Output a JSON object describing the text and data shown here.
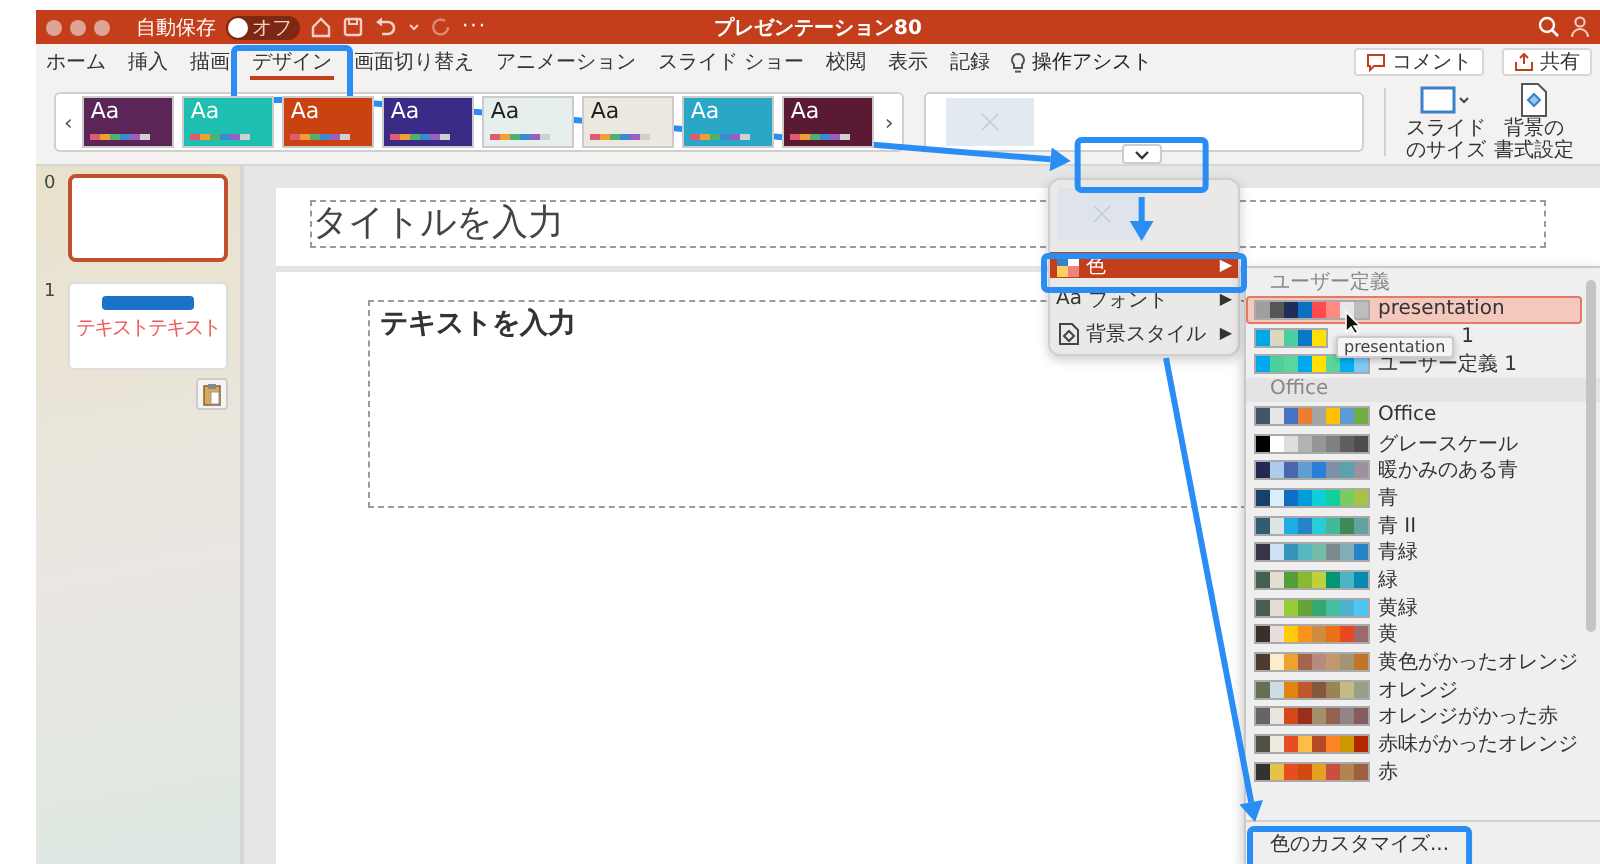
{
  "window": {
    "autosave_label": "自動保存",
    "autosave_on": false,
    "autosave_state": "オフ",
    "more": "···",
    "title": "プレゼンテーション80"
  },
  "ribbon_tabs": [
    {
      "label": "ホーム",
      "selected": false
    },
    {
      "label": "挿入",
      "selected": false
    },
    {
      "label": "描画",
      "selected": false
    },
    {
      "label": "デザイン",
      "selected": true
    },
    {
      "label": "画面切り替え",
      "selected": false
    },
    {
      "label": "アニメーション",
      "selected": false
    },
    {
      "label": "スライド ショー",
      "selected": false
    },
    {
      "label": "校閲",
      "selected": false
    },
    {
      "label": "表示",
      "selected": false
    },
    {
      "label": "記録",
      "selected": false
    }
  ],
  "tell_me": "操作アシスト",
  "header_buttons": [
    {
      "kind": "comment",
      "label": "コメント"
    },
    {
      "kind": "share",
      "label": "共有"
    }
  ],
  "gallery": {
    "prev": "‹",
    "next": "›"
  },
  "themes": [
    {
      "label": "Aa",
      "color": "#5b2558"
    },
    {
      "label": "Aa",
      "color": "#1ebfb0"
    },
    {
      "label": "Aa",
      "color": "#c9420f"
    },
    {
      "label": "Aa",
      "color": "#3b2a86"
    },
    {
      "label": "Aa",
      "color": "#e6eeee"
    },
    {
      "label": "Aa",
      "color": "#ece8df"
    },
    {
      "label": "Aa",
      "color": "#2aa6c6"
    },
    {
      "label": "Aa",
      "color": "#5a1a34"
    }
  ],
  "design_buttons": [
    {
      "kind": "slide-size",
      "lines": [
        "スライド",
        "のサイズ"
      ]
    },
    {
      "kind": "background",
      "lines": [
        "背景の",
        "書式設定"
      ]
    }
  ],
  "slides": [
    {
      "number": "0",
      "selected": true,
      "paste_options": false
    },
    {
      "number": "1",
      "selected": false,
      "paste_options": true,
      "text": "テキストテキスト"
    }
  ],
  "slide": {
    "title_placeholder": "タイトルを入力",
    "body_placeholder": "テキストを入力"
  },
  "variants_menu": {
    "items": [
      {
        "kind": "colors",
        "label": "色",
        "arrow": "▶",
        "selected": true
      },
      {
        "kind": "fonts",
        "icon_text": "Aa",
        "label": "フォント",
        "arrow": "▶",
        "selected": false
      },
      {
        "kind": "background",
        "label": "背景スタイル",
        "arrow": "▶",
        "selected": false
      }
    ]
  },
  "colors_submenu": {
    "sections": [
      {
        "title": "ユーザー定義",
        "schemes": [
          {
            "name": "presentation",
            "selected": true,
            "swatches": [
              {
                "color": "#9e9e9e"
              },
              {
                "color": "#555555"
              },
              {
                "color": "#1f2d5a"
              },
              {
                "color": "#0a70c0"
              },
              {
                "color": "#ff4b4b"
              },
              {
                "color": "#ff8a80"
              },
              {
                "color": "#e8e8e8"
              },
              {
                "color": "#bdbdbd"
              }
            ]
          },
          {
            "name": "1",
            "selected": false,
            "tooltip": "presentation",
            "swatches": [
              {
                "color": "#00a8e8"
              },
              {
                "color": "#dcd8c0"
              },
              {
                "color": "#4ccfa0"
              },
              {
                "color": "#0a78c8"
              },
              {
                "color": "#ffe000"
              }
            ]
          },
          {
            "name": "ユーザー定義 1",
            "selected": false,
            "swatches": [
              {
                "color": "#00a8f0"
              },
              {
                "color": "#4ccf9a"
              },
              {
                "color": "#5ad69c"
              },
              {
                "color": "#00a8f0"
              },
              {
                "color": "#ffe000"
              },
              {
                "color": "#5ad69c"
              },
              {
                "color": "#00b0f0"
              },
              {
                "color": "#7fc8f8"
              }
            ]
          }
        ]
      },
      {
        "title": "Office",
        "schemes": [
          {
            "name": "Office",
            "selected": false,
            "swatches": [
              {
                "color": "#44546a"
              },
              {
                "color": "#e7e6e6"
              },
              {
                "color": "#4472c4"
              },
              {
                "color": "#ed7d31"
              },
              {
                "color": "#a5a5a5"
              },
              {
                "color": "#ffc000"
              },
              {
                "color": "#5b9bd5"
              },
              {
                "color": "#70ad47"
              }
            ]
          },
          {
            "name": "グレースケール",
            "selected": false,
            "swatches": [
              {
                "color": "#000000"
              },
              {
                "color": "#ffffff"
              },
              {
                "color": "#dddddd"
              },
              {
                "color": "#b2b2b2"
              },
              {
                "color": "#969696"
              },
              {
                "color": "#808080"
              },
              {
                "color": "#5f5f5f"
              },
              {
                "color": "#4d4d4d"
              }
            ]
          },
          {
            "name": "暖かみのある青",
            "selected": false,
            "swatches": [
              {
                "color": "#242852"
              },
              {
                "color": "#acccea"
              },
              {
                "color": "#4a66ac"
              },
              {
                "color": "#629dd1"
              },
              {
                "color": "#297fd5"
              },
              {
                "color": "#7f8fa9"
              },
              {
                "color": "#5aa2ae"
              },
              {
                "color": "#9d90a0"
              }
            ]
          },
          {
            "name": "青",
            "selected": false,
            "swatches": [
              {
                "color": "#17406d"
              },
              {
                "color": "#dbeff9"
              },
              {
                "color": "#0f6fc6"
              },
              {
                "color": "#009dd9"
              },
              {
                "color": "#0bd0d9"
              },
              {
                "color": "#10cf9b"
              },
              {
                "color": "#7cca62"
              },
              {
                "color": "#a5c249"
              }
            ]
          },
          {
            "name": "青 II",
            "selected": false,
            "swatches": [
              {
                "color": "#335b74"
              },
              {
                "color": "#dfe3e5"
              },
              {
                "color": "#1cade4"
              },
              {
                "color": "#2683c6"
              },
              {
                "color": "#27ced7"
              },
              {
                "color": "#42ba97"
              },
              {
                "color": "#3e8853"
              },
              {
                "color": "#62a39f"
              }
            ]
          },
          {
            "name": "青緑",
            "selected": false,
            "swatches": [
              {
                "color": "#373545"
              },
              {
                "color": "#cee1f2"
              },
              {
                "color": "#3494ba"
              },
              {
                "color": "#58b6c0"
              },
              {
                "color": "#75bda7"
              },
              {
                "color": "#7a8c8e"
              },
              {
                "color": "#84acb6"
              },
              {
                "color": "#2683c6"
              }
            ]
          },
          {
            "name": "緑",
            "selected": false,
            "swatches": [
              {
                "color": "#455f51"
              },
              {
                "color": "#e3ded1"
              },
              {
                "color": "#549e39"
              },
              {
                "color": "#8ab833"
              },
              {
                "color": "#c0cf3a"
              },
              {
                "color": "#029676"
              },
              {
                "color": "#4ab5c4"
              },
              {
                "color": "#0989b1"
              }
            ]
          },
          {
            "name": "黄緑",
            "selected": false,
            "swatches": [
              {
                "color": "#455f51"
              },
              {
                "color": "#e3ded1"
              },
              {
                "color": "#99cb38"
              },
              {
                "color": "#63a537"
              },
              {
                "color": "#37a76f"
              },
              {
                "color": "#44c1a3"
              },
              {
                "color": "#4eb3cf"
              },
              {
                "color": "#51c3f9"
              }
            ]
          },
          {
            "name": "黄",
            "selected": false,
            "swatches": [
              {
                "color": "#39302a"
              },
              {
                "color": "#e5dedb"
              },
              {
                "color": "#ffca08"
              },
              {
                "color": "#f8931d"
              },
              {
                "color": "#ce8d3e"
              },
              {
                "color": "#ec7016"
              },
              {
                "color": "#e64823"
              },
              {
                "color": "#9c6a6a"
              }
            ]
          },
          {
            "name": "黄色がかったオレンジ",
            "selected": false,
            "swatches": [
              {
                "color": "#4e3b30"
              },
              {
                "color": "#fbeec9"
              },
              {
                "color": "#f0a22e"
              },
              {
                "color": "#a5644e"
              },
              {
                "color": "#b58b80"
              },
              {
                "color": "#c3986d"
              },
              {
                "color": "#a19574"
              },
              {
                "color": "#c17529"
              }
            ]
          },
          {
            "name": "オレンジ",
            "selected": false,
            "swatches": [
              {
                "color": "#637052"
              },
              {
                "color": "#ccddea"
              },
              {
                "color": "#e48312"
              },
              {
                "color": "#bd582c"
              },
              {
                "color": "#865640"
              },
              {
                "color": "#9b8357"
              },
              {
                "color": "#c2bc80"
              },
              {
                "color": "#94a088"
              }
            ]
          },
          {
            "name": "オレンジがかった赤",
            "selected": false,
            "swatches": [
              {
                "color": "#696464"
              },
              {
                "color": "#e9e5dc"
              },
              {
                "color": "#d34817"
              },
              {
                "color": "#9b2d1f"
              },
              {
                "color": "#a28e6a"
              },
              {
                "color": "#956251"
              },
              {
                "color": "#918485"
              },
              {
                "color": "#855d5d"
              }
            ]
          },
          {
            "name": "赤味がかったオレンジ",
            "selected": false,
            "swatches": [
              {
                "color": "#505046"
              },
              {
                "color": "#eeece1"
              },
              {
                "color": "#e84c22"
              },
              {
                "color": "#ffbd47"
              },
              {
                "color": "#b64926"
              },
              {
                "color": "#ff8427"
              },
              {
                "color": "#cc9900"
              },
              {
                "color": "#b22600"
              }
            ]
          },
          {
            "name": "赤",
            "selected": false,
            "swatches": [
              {
                "color": "#323232"
              },
              {
                "color": "#e5c243"
              },
              {
                "color": "#e84c22"
              },
              {
                "color": "#d04a10"
              },
              {
                "color": "#e6a020"
              },
              {
                "color": "#c8503c"
              },
              {
                "color": "#b0844c"
              },
              {
                "color": "#9c6040"
              }
            ]
          }
        ]
      }
    ],
    "customize": "色のカスタマイズ..."
  }
}
